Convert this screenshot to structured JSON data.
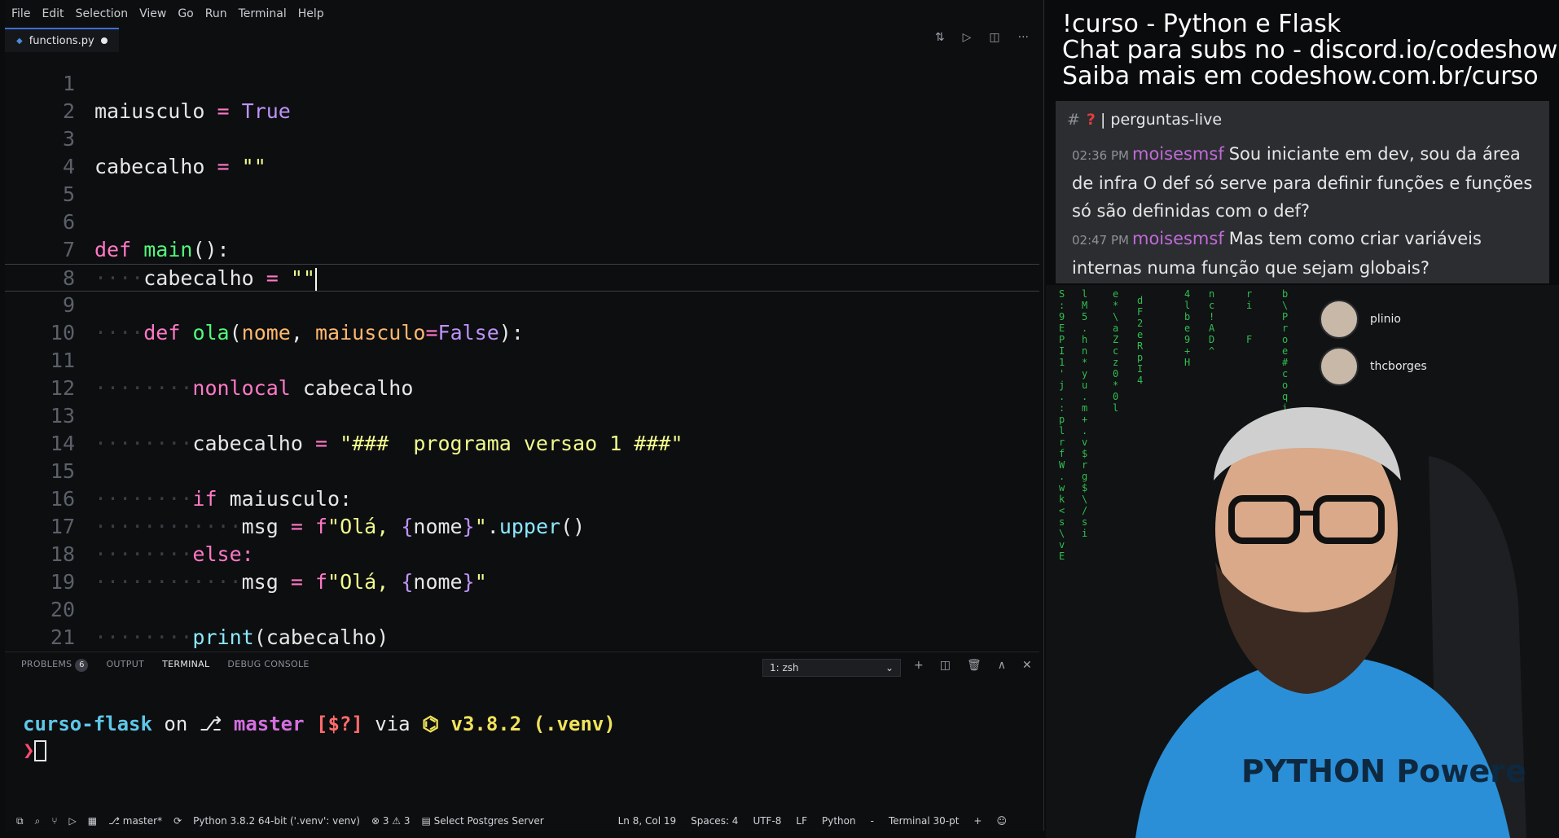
{
  "menubar": {
    "items": [
      "File",
      "Edit",
      "Selection",
      "View",
      "Go",
      "Run",
      "Terminal",
      "Help"
    ]
  },
  "tab": {
    "filename": "functions.py"
  },
  "code": {
    "line_numbers": [
      "1",
      "2",
      "3",
      "4",
      "5",
      "6",
      "7",
      "8",
      "9",
      "10",
      "11",
      "12",
      "13",
      "14",
      "15",
      "16",
      "17",
      "18",
      "19",
      "20",
      "21"
    ],
    "l2": {
      "var": "maiusculo",
      "eq": "=",
      "val": "True"
    },
    "l4": {
      "var": "cabecalho",
      "eq": "=",
      "val": "\"\""
    },
    "l7": {
      "kw": "def",
      "name": "main",
      "rest": "():"
    },
    "l8": {
      "var": "cabecalho",
      "eq": "=",
      "val": "\"\""
    },
    "l10": {
      "kw": "def",
      "name": "ola",
      "open": "(",
      "p1": "nome",
      "comma": ", ",
      "p2": "maiusculo",
      "eq": "=",
      "def": "False",
      "close": "):"
    },
    "l12": {
      "kw": "nonlocal",
      "var": "cabecalho"
    },
    "l14": {
      "var": "cabecalho",
      "eq": "=",
      "val": "\"###  programa versao 1 ###\""
    },
    "l16": {
      "kw": "if",
      "rest": "maiusculo:"
    },
    "l17": {
      "var": "msg",
      "eq": "=",
      "f": "f",
      "s1": "\"Olá, ",
      "ob": "{",
      "n": "nome",
      "cb": "}",
      "s2": "\"",
      "dot": ".",
      "meth": "upper",
      "call": "()"
    },
    "l18": {
      "kw": "else:"
    },
    "l19": {
      "var": "msg",
      "eq": "=",
      "f": "f",
      "s1": "\"Olá, ",
      "ob": "{",
      "n": "nome",
      "cb": "}",
      "s2": "\""
    },
    "l21": {
      "fn": "print",
      "rest": "(cabecalho)"
    }
  },
  "panel": {
    "tabs": {
      "problems": "PROBLEMS",
      "problems_count": "6",
      "output": "OUTPUT",
      "terminal": "TERMINAL",
      "debug": "DEBUG CONSOLE"
    },
    "terminal_select": "1: zsh",
    "term": {
      "dir": "curso-flask",
      "on": "on",
      "branch": "master",
      "status": "[$?]",
      "via": "via",
      "version": "v3.8.2 (.venv)",
      "prompt": "❯"
    }
  },
  "statusbar": {
    "branch": "master*",
    "python": "Python 3.8.2 64-bit ('.venv': venv)",
    "problems": "⊗ 3 ⚠ 3",
    "postgres": "Select Postgres Server",
    "position": "Ln 8, Col 19",
    "spaces": "Spaces: 4",
    "encoding": "UTF-8",
    "eol": "LF",
    "language": "Python",
    "terminal": "Terminal 30-pt"
  },
  "overlay": {
    "line1": "!curso - Python e Flask",
    "line2": "Chat para subs no - discord.io/codeshow",
    "line3": "Saiba mais em  codeshow.com.br/curso"
  },
  "discord": {
    "channel": "perguntas-live",
    "messages": [
      {
        "time": "02:36 PM",
        "user": "moisesmsf",
        "text": "Sou iniciante em dev, sou da área de infra O def só serve para definir funções e funções só são definidas com o def?"
      },
      {
        "time": "02:47 PM",
        "user": "moisesmsf",
        "text": "Mas tem como criar variáveis internas numa função que sejam globais?"
      }
    ]
  },
  "viewers": [
    {
      "name": "plinio"
    },
    {
      "name": "thcborges"
    }
  ],
  "shirt_text": "PYTHON Powered",
  "colors": {
    "accent": "#3d6fd6",
    "keyword": "#ff79c6",
    "function": "#50fa7b",
    "string": "#f1fa8c",
    "boolean": "#bd93f9",
    "parameter": "#ffb86c",
    "discord_user": "#c06bd6"
  }
}
